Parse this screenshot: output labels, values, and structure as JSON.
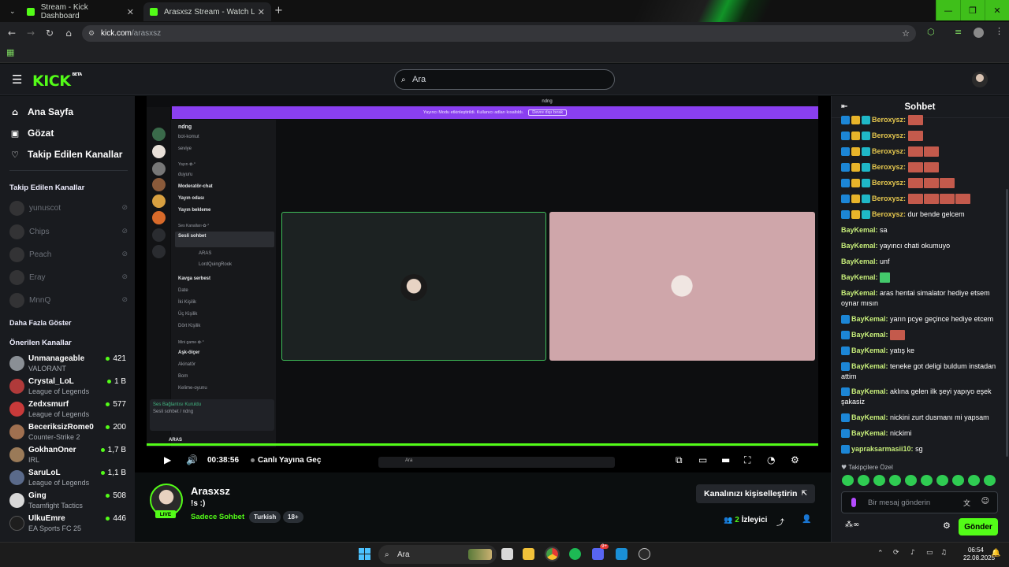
{
  "browser": {
    "tabs": [
      {
        "title": "Stream - Kick Dashboard"
      },
      {
        "title": "Arasxsz Stream - Watch Live on"
      }
    ],
    "url_host": "kick.com",
    "url_path": "/arasxsz"
  },
  "kick": {
    "logo": "KICK",
    "logo_badge": "BETA",
    "search_placeholder": "Ara"
  },
  "sidebar": {
    "nav": [
      {
        "label": "Ana Sayfa",
        "icon": "home-icon"
      },
      {
        "label": "Gözat",
        "icon": "browse-icon"
      },
      {
        "label": "Takip Edilen Kanallar",
        "icon": "heart-icon"
      }
    ],
    "following_header": "Takip Edilen Kanallar",
    "following": [
      {
        "name": "yunuscot"
      },
      {
        "name": "Chips"
      },
      {
        "name": "Peach"
      },
      {
        "name": "Eray"
      },
      {
        "name": "MnnQ"
      }
    ],
    "show_more": "Daha Fazla Göster",
    "recommended_header": "Önerilen Kanallar",
    "recommended": [
      {
        "name": "Unmanageable",
        "game": "VALORANT",
        "viewers": "421"
      },
      {
        "name": "Crystal_LoL",
        "game": "League of Legends",
        "viewers": "1 B"
      },
      {
        "name": "Zedxsmurf",
        "game": "League of Legends",
        "viewers": "577"
      },
      {
        "name": "BeceriksizRome0",
        "game": "Counter-Strike 2",
        "viewers": "200"
      },
      {
        "name": "GokhanOner",
        "game": "IRL",
        "viewers": "1,7 B"
      },
      {
        "name": "SaruLoL",
        "game": "League of Legends",
        "viewers": "1,1 B"
      },
      {
        "name": "Ging",
        "game": "Teamfight Tactics",
        "viewers": "508"
      },
      {
        "name": "UlkuEmre",
        "game": "EA Sports FC 25",
        "viewers": "446"
      }
    ]
  },
  "discord": {
    "window_title": "ndng",
    "server_name": "ndng",
    "banner_text": "Yayıncı Modu etkinleştirildi. Kullanıcı adları kısaltıldı.",
    "banner_button": "Devre dışı bırak",
    "channels": [
      "bot-komut",
      "seviye",
      "Yayın·✿·°",
      "duyuru",
      "Moderatör-chat",
      "Yayın odası",
      "Yayın bekleme",
      "Ses Kanalları·✿·°",
      "Sesli sohbet",
      "ARAS",
      "LordQuingRook",
      "Kavga serbest",
      "Date",
      "İki Kişilik",
      "Üç Kişilik",
      "Dört Kişilik",
      "Mini game·✿·°",
      "Aşk-ölçer",
      "Akinatör",
      "Bom",
      "Kelime-oyunu"
    ],
    "voice_status": "Ses Bağlantısı Kuruldu",
    "voice_channel": "Sesli sohbet / ndng",
    "user_name": "ARAS",
    "taskbar_search": "Ara"
  },
  "player": {
    "time": "00:38:56",
    "go_live": "Canlı Yayına Geç",
    "progress": 1.0
  },
  "stream": {
    "name": "Arasxsz",
    "title": "!s :)",
    "category": "Sadece Sohbet",
    "tags": [
      "Turkish",
      "18+"
    ],
    "live_label": "LIVE",
    "customize_label": "Kanalınızı kişiselleştirin",
    "viewer_count": "2",
    "viewer_label": "İzleyici"
  },
  "chat": {
    "title": "Sohbet",
    "messages": [
      {
        "user": "Beroxysz:",
        "text": "",
        "emotes": 1,
        "badges": 3
      },
      {
        "user": "Beroxysz:",
        "text": "",
        "emotes": 1,
        "badges": 3
      },
      {
        "user": "Beroxysz:",
        "text": "",
        "emotes": 2,
        "badges": 3
      },
      {
        "user": "Beroxysz:",
        "text": "",
        "emotes": 2,
        "badges": 3
      },
      {
        "user": "Beroxysz:",
        "text": "",
        "emotes": 3,
        "badges": 3
      },
      {
        "user": "Beroxysz:",
        "text": "",
        "emotes": 4,
        "badges": 3
      },
      {
        "user": "Beroxysz:",
        "text": "dur bende gelcem",
        "emotes": 0,
        "badges": 3
      },
      {
        "user": "BayKemal:",
        "text": "sa",
        "emotes": 0,
        "badges": 0
      },
      {
        "user": "BayKemal:",
        "text": "yayıncı chati okumuyo",
        "emotes": 0,
        "badges": 0
      },
      {
        "user": "BayKemal:",
        "text": "unf",
        "emotes": 0,
        "badges": 0
      },
      {
        "user": "BayKemal:",
        "text": "",
        "emotes": 1,
        "badges": 0,
        "green": true
      },
      {
        "user": "BayKemal:",
        "text": "aras hentai simalator hediye etsem oynar mısın",
        "emotes": 0,
        "badges": 0
      },
      {
        "user": "BayKemal:",
        "text": "yarın pcye geçince hediye etcem",
        "emotes": 0,
        "badges": 1
      },
      {
        "user": "BayKemal:",
        "text": "",
        "emotes": 1,
        "badges": 1
      },
      {
        "user": "BayKemal:",
        "text": "yatış ke",
        "emotes": 0,
        "badges": 1
      },
      {
        "user": "BayKemal:",
        "text": "teneke got deligi buldum instadan attim",
        "emotes": 0,
        "badges": 1
      },
      {
        "user": "BayKemal:",
        "text": "aklına gelen ilk şeyi yapıyo eşek şakasiz",
        "emotes": 0,
        "badges": 1
      },
      {
        "user": "BayKemal:",
        "text": "nickini zurt dusmanı mi yapsam",
        "emotes": 0,
        "badges": 1
      },
      {
        "user": "BayKemal:",
        "text": "nickimi",
        "emotes": 0,
        "badges": 1
      },
      {
        "user": "yapraksarmasii10:",
        "text": "sg",
        "emotes": 0,
        "badges": 1
      }
    ],
    "pinned_label": "Takipçilere Özel",
    "input_placeholder": "Bir mesaj gönderin",
    "send_label": "Gönder"
  },
  "taskbar": {
    "search": "Ara",
    "time": "06:54",
    "date": "22.08.2025",
    "notification_count": "9+"
  }
}
